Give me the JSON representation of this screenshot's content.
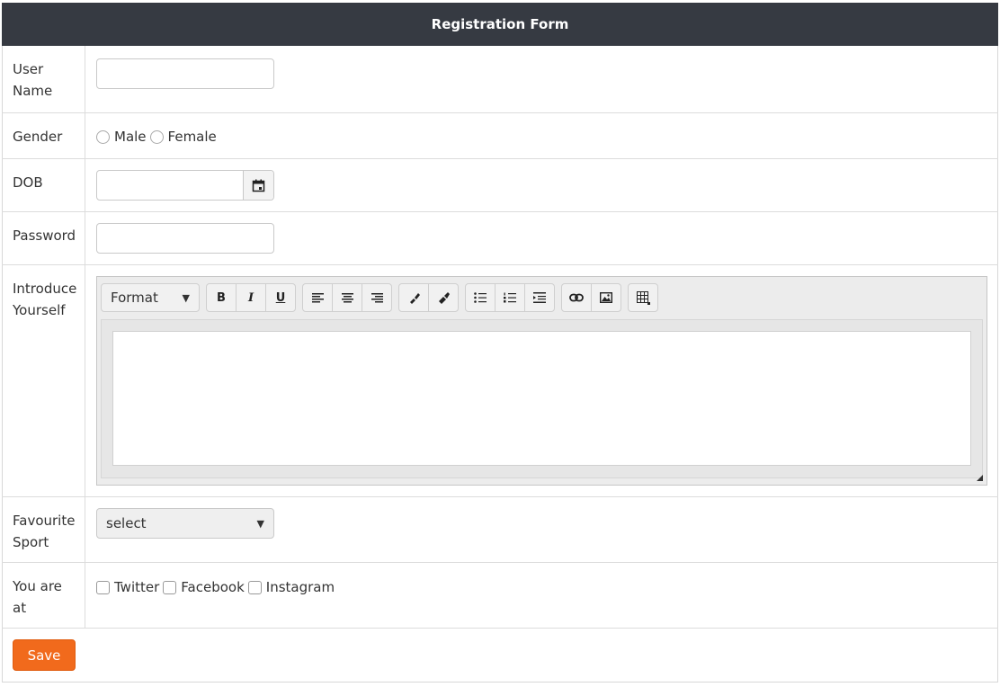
{
  "form": {
    "title": "Registration Form",
    "labels": {
      "username": [
        "User",
        "Name"
      ],
      "gender": "Gender",
      "dob": "DOB",
      "password": "Password",
      "introduce": [
        "Introduce",
        "Yourself"
      ],
      "sport": [
        "Favourite",
        "Sport"
      ],
      "social": [
        "You are",
        "at"
      ]
    },
    "gender_options": [
      "Male",
      "Female"
    ],
    "editor": {
      "format_label": "Format"
    },
    "sport_select": {
      "value": "select"
    },
    "social_options": [
      "Twitter",
      "Facebook",
      "Instagram"
    ],
    "save_label": "Save"
  },
  "colors": {
    "header": "#363a42",
    "save": "#f16a1c"
  }
}
